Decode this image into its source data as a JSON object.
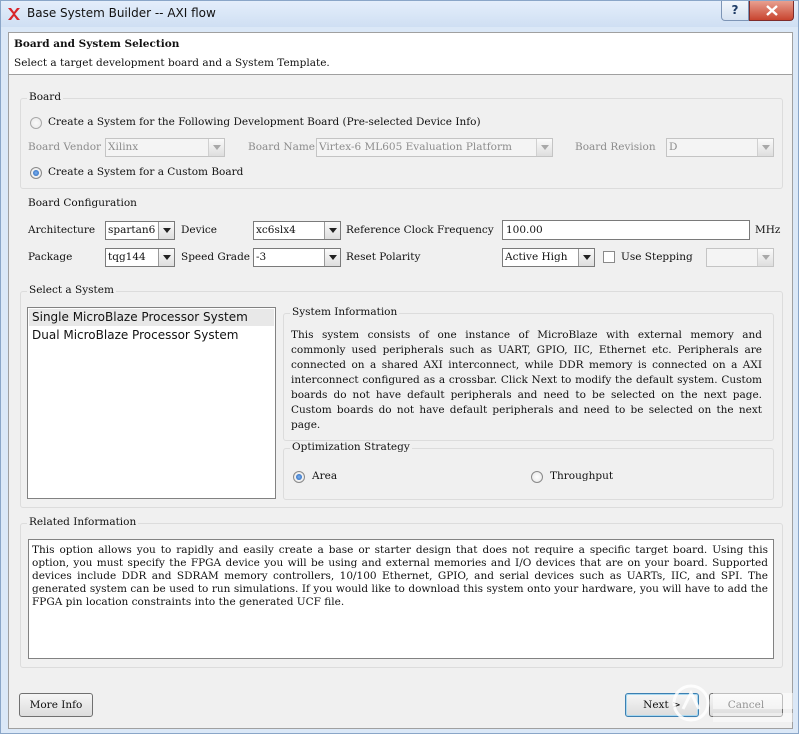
{
  "window": {
    "title": "Base System Builder -- AXI flow",
    "help_label": "?"
  },
  "header": {
    "title": "Board and System Selection",
    "subtitle": "Select a target development board and a System Template."
  },
  "board": {
    "legend": "Board",
    "option_dev_board": "Create a System for the Following Development Board (Pre-selected Device Info)",
    "vendor_label": "Board Vendor",
    "vendor_value": "Xilinx",
    "name_label": "Board Name",
    "name_value": "Virtex-6 ML605 Evaluation Platform",
    "revision_label": "Board Revision",
    "revision_value": "D",
    "option_custom_board": "Create a System for a Custom Board"
  },
  "board_config": {
    "legend": "Board Configuration",
    "architecture_label": "Architecture",
    "architecture_value": "spartan6",
    "device_label": "Device",
    "device_value": "xc6slx4",
    "ref_clock_label": "Reference Clock Frequency",
    "ref_clock_value": "100.00",
    "ref_clock_unit": "MHz",
    "package_label": "Package",
    "package_value": "tqg144",
    "speed_label": "Speed Grade",
    "speed_value": "-3",
    "reset_label": "Reset Polarity",
    "reset_value": "Active High",
    "stepping_label": "Use Stepping",
    "stepping_value": ""
  },
  "select_system": {
    "legend": "Select a System",
    "items": [
      "Single MicroBlaze Processor System",
      "Dual MicroBlaze Processor System"
    ],
    "info_legend": "System Information",
    "info_text": "This system consists of one instance of MicroBlaze with external memory and commonly used peripherals such as UART, GPIO, IIC, Ethernet etc. Peripherals are connected on a shared AXI interconnect, while DDR memory is connected on a AXI interconnect configured as a crossbar. Click Next to modify the default system. Custom boards do not have default peripherals and need to be selected on the next page. Custom boards do not have default peripherals and need to be selected on the next page.",
    "opt_legend": "Optimization Strategy",
    "opt_area": "Area",
    "opt_throughput": "Throughput"
  },
  "related": {
    "legend": "Related Information",
    "text": "This option allows you to rapidly and easily create a base or starter design that does not require a specific target board. Using this option, you must specify the FPGA device you will be using and external memories and I/O devices that are on your board. Supported devices include DDR and SDRAM memory controllers, 10/100 Ethernet, GPIO, and serial devices such as UARTs, IIC, and SPI. The generated system can be used to run simulations. If you would like to download this system onto your hardware, you will have to add the FPGA pin location constraints into the generated UCF file."
  },
  "footer": {
    "more_info": "More Info",
    "next": "Next >",
    "cancel": "Cancel"
  },
  "colors": {
    "accent": "#1d5fb8",
    "titlebar": "#dbe8f7",
    "close": "#c8442f"
  }
}
